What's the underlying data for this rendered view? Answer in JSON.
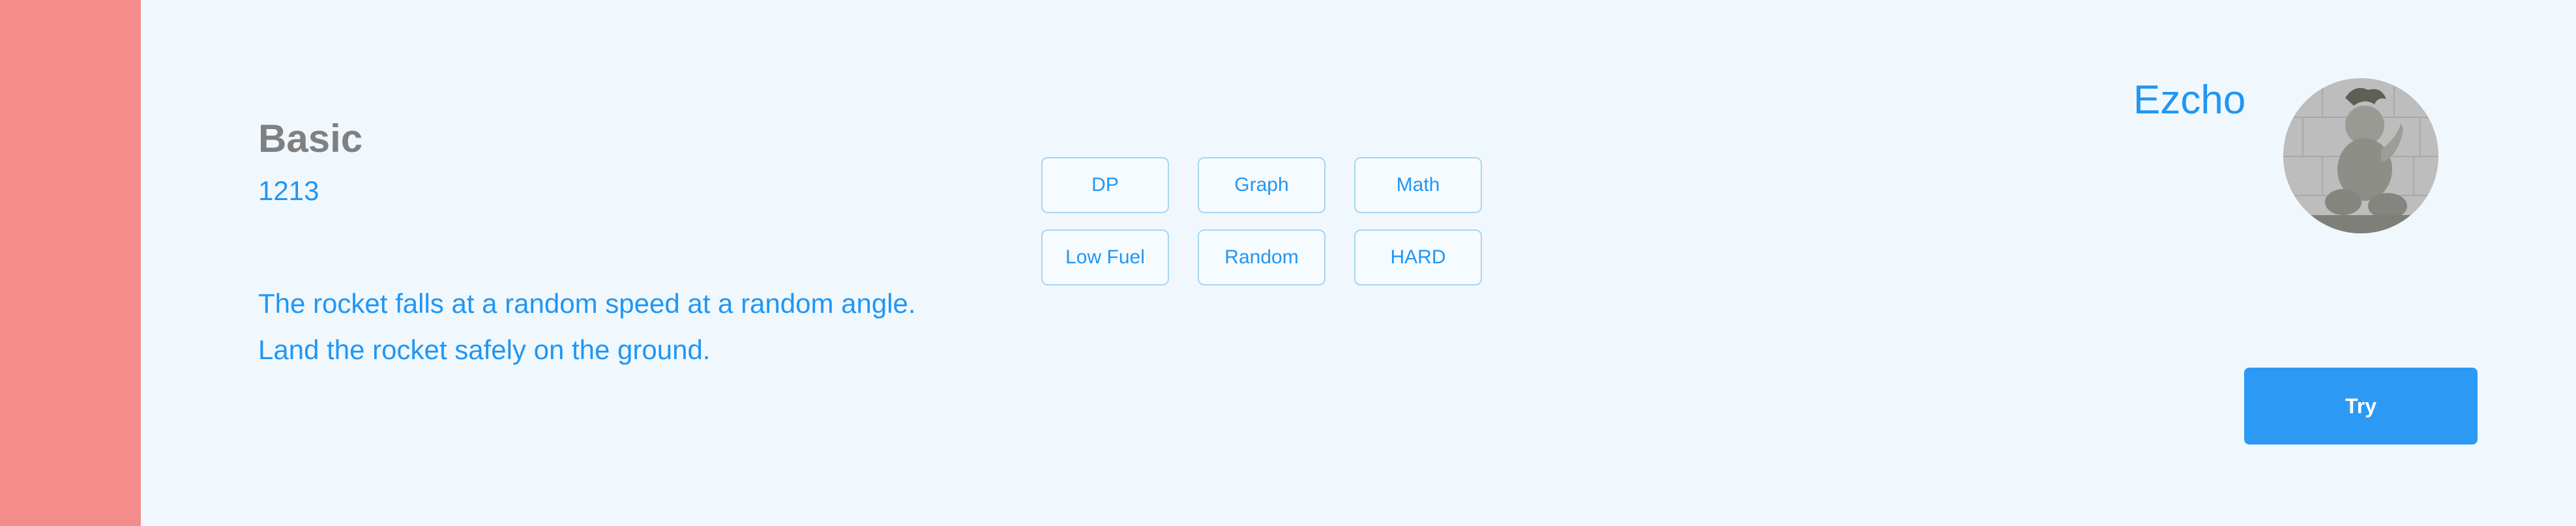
{
  "colors": {
    "background": "#f0f8fe",
    "side_strip": "#f48c8c",
    "accent": "#2196f3",
    "title": "#808080",
    "tag_border": "#a9d5ef",
    "button": "#2c9af5"
  },
  "problem": {
    "title": "Basic",
    "number": "1213",
    "description": [
      "The rocket falls at a random speed at a random angle.",
      "Land the rocket safely on the ground."
    ]
  },
  "tags": [
    "DP",
    "Graph",
    "Math",
    "Low Fuel",
    "Random",
    "HARD"
  ],
  "author": {
    "name": "Ezcho",
    "avatar_icon": "stone-statue-avatar"
  },
  "actions": {
    "try_label": "Try"
  }
}
